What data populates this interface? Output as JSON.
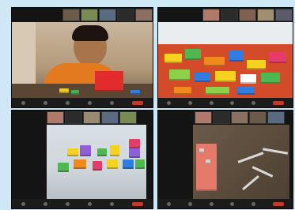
{
  "window": {
    "title": ""
  },
  "tiles": [
    {
      "name": "video-tile-child-with-bricks",
      "speaker_label": ""
    },
    {
      "name": "video-tile-brick-pile",
      "speaker_label": ""
    },
    {
      "name": "video-tile-brick-figures",
      "speaker_label": ""
    },
    {
      "name": "video-tile-bricks-on-table",
      "speaker_label": ""
    }
  ],
  "icons": [
    "mic-icon",
    "video-icon",
    "participants-icon",
    "share-icon",
    "chat-icon",
    "end-button"
  ],
  "colors": {
    "accent": "#c0392b",
    "background": "#cfe8f6",
    "tile_bg": "#141414"
  }
}
